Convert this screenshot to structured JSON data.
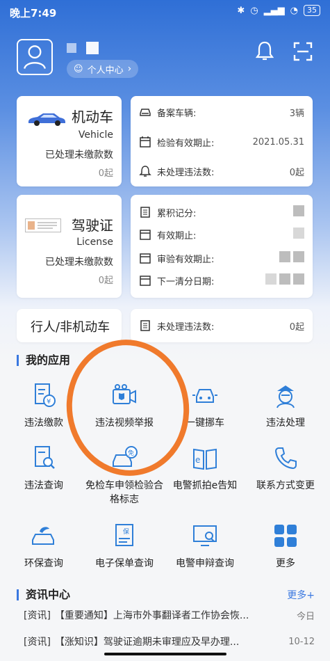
{
  "status_bar": {
    "time": "晚上7:49",
    "battery": "35"
  },
  "header": {
    "personal_center": "个人中心"
  },
  "vehicle_card": {
    "title": "机动车",
    "subtitle": "Vehicle",
    "pending_label": "已处理未缴款数",
    "pending_value": "0起"
  },
  "vehicle_info": {
    "rows": [
      {
        "label": "备案车辆:",
        "value": "3辆",
        "icon": "car-icon"
      },
      {
        "label": "检验有效期止:",
        "value": "2021.05.31",
        "icon": "calendar-icon"
      },
      {
        "label": "未处理违法数:",
        "value": "0起",
        "icon": "bell-icon"
      }
    ]
  },
  "license_card": {
    "title": "驾驶证",
    "subtitle": "License",
    "pending_label": "已处理未缴款数",
    "pending_value": "0起"
  },
  "license_info": {
    "rows": [
      {
        "label": "累积记分:",
        "icon": "document-icon"
      },
      {
        "label": "有效期止:",
        "icon": "calendar-icon"
      },
      {
        "label": "审验有效期止:",
        "icon": "calendar-icon"
      },
      {
        "label": "下一清分日期:",
        "icon": "calendar-icon"
      }
    ]
  },
  "pedestrian_card": {
    "title": "行人/非机动车",
    "row_label": "未处理违法数:",
    "row_value": "0起"
  },
  "my_apps": {
    "title": "我的应用",
    "items": [
      {
        "label": "违法缴款",
        "icon": "payment-icon"
      },
      {
        "label": "违法视频举报",
        "icon": "video-report-icon"
      },
      {
        "label": "一键挪车",
        "icon": "move-car-icon"
      },
      {
        "label": "违法处理",
        "icon": "police-icon"
      },
      {
        "label": "违法查询",
        "icon": "query-icon"
      },
      {
        "label": "免检车申领检验合格标志",
        "icon": "exempt-car-icon"
      },
      {
        "label": "电警抓拍e告知",
        "icon": "e-notice-icon"
      },
      {
        "label": "联系方式变更",
        "icon": "phone-icon"
      },
      {
        "label": "环保查询",
        "icon": "eco-car-icon"
      },
      {
        "label": "电子保单查询",
        "icon": "insurance-icon"
      },
      {
        "label": "电警申辩查询",
        "icon": "appeal-icon"
      },
      {
        "label": "更多",
        "icon": "more-grid-icon"
      }
    ]
  },
  "news": {
    "title": "资讯中心",
    "more": "更多+",
    "items": [
      {
        "tag": "[资讯]",
        "text": "【重要通知】上海市外事翻译者工作协会恢...",
        "date": "今日"
      },
      {
        "tag": "[资讯]",
        "text": "【涨知识】驾驶证逾期未审理应及早办理...",
        "date": "10-12"
      }
    ]
  },
  "colors": {
    "primary": "#3a78e0",
    "annotation": "#f07a2c"
  }
}
